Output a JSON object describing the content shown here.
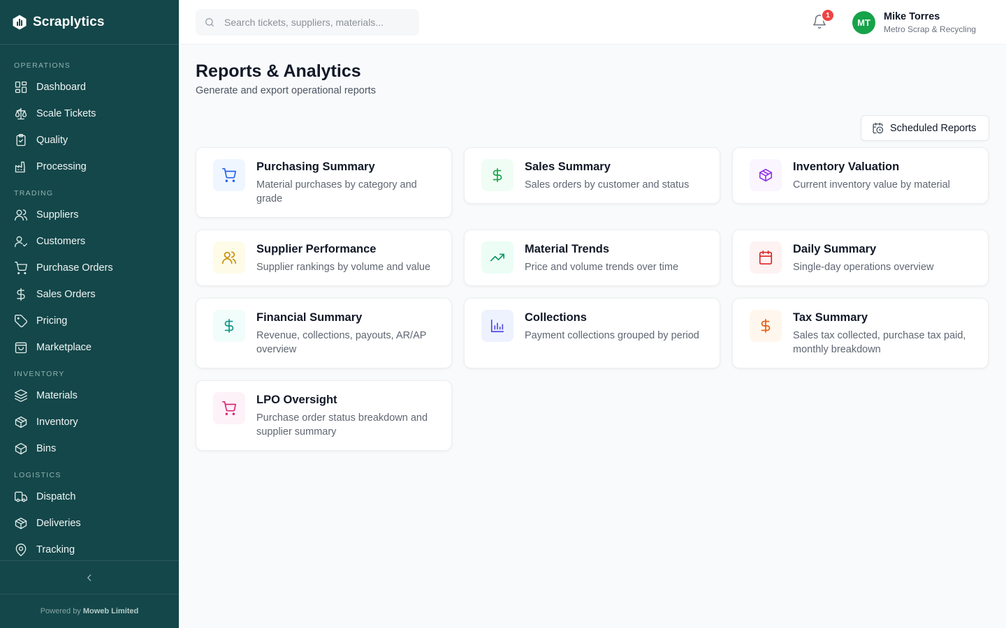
{
  "app": {
    "name": "Scraplytics"
  },
  "sidebar": {
    "sections": [
      {
        "label": "OPERATIONS",
        "items": [
          {
            "label": "Dashboard",
            "icon": "dashboard-icon"
          },
          {
            "label": "Scale Tickets",
            "icon": "scale-icon"
          },
          {
            "label": "Quality",
            "icon": "clipboard-check-icon"
          },
          {
            "label": "Processing",
            "icon": "factory-icon"
          }
        ]
      },
      {
        "label": "TRADING",
        "items": [
          {
            "label": "Suppliers",
            "icon": "users-icon"
          },
          {
            "label": "Customers",
            "icon": "user-check-icon"
          },
          {
            "label": "Purchase Orders",
            "icon": "cart-icon"
          },
          {
            "label": "Sales Orders",
            "icon": "dollar-icon"
          },
          {
            "label": "Pricing",
            "icon": "tag-icon"
          },
          {
            "label": "Marketplace",
            "icon": "shopping-bag-icon"
          }
        ]
      },
      {
        "label": "INVENTORY",
        "items": [
          {
            "label": "Materials",
            "icon": "layers-icon"
          },
          {
            "label": "Inventory",
            "icon": "package-icon"
          },
          {
            "label": "Bins",
            "icon": "box-icon"
          }
        ]
      },
      {
        "label": "LOGISTICS",
        "items": [
          {
            "label": "Dispatch",
            "icon": "truck-icon"
          },
          {
            "label": "Deliveries",
            "icon": "package-check-icon"
          },
          {
            "label": "Tracking",
            "icon": "map-pin-icon"
          }
        ]
      }
    ],
    "footer": {
      "powered_by": "Powered by",
      "company": "Moweb Limited"
    }
  },
  "header": {
    "search_placeholder": "Search tickets, suppliers, materials...",
    "notifications_count": "1",
    "user": {
      "initials": "MT",
      "name": "Mike Torres",
      "org": "Metro Scrap & Recycling"
    }
  },
  "page": {
    "title": "Reports & Analytics",
    "subtitle": "Generate and export operational reports",
    "scheduled_button": "Scheduled Reports"
  },
  "reports": [
    {
      "title": "Purchasing Summary",
      "description": "Material purchases by category and grade",
      "icon": "cart-icon",
      "icon_color": "#2563eb",
      "icon_bg": "#eff6ff"
    },
    {
      "title": "Sales Summary",
      "description": "Sales orders by customer and status",
      "icon": "dollar-icon",
      "icon_color": "#16a34a",
      "icon_bg": "#f0fdf4"
    },
    {
      "title": "Inventory Valuation",
      "description": "Current inventory value by material",
      "icon": "package-icon",
      "icon_color": "#9333ea",
      "icon_bg": "#faf5ff"
    },
    {
      "title": "Supplier Performance",
      "description": "Supplier rankings by volume and value",
      "icon": "users-icon",
      "icon_color": "#ca8a04",
      "icon_bg": "#fefce8"
    },
    {
      "title": "Material Trends",
      "description": "Price and volume trends over time",
      "icon": "trending-up-icon",
      "icon_color": "#059669",
      "icon_bg": "#ecfdf5"
    },
    {
      "title": "Daily Summary",
      "description": "Single-day operations overview",
      "icon": "calendar-icon",
      "icon_color": "#dc2626",
      "icon_bg": "#fef2f2"
    },
    {
      "title": "Financial Summary",
      "description": "Revenue, collections, payouts, AR/AP overview",
      "icon": "dollar-icon",
      "icon_color": "#0d9488",
      "icon_bg": "#f0fdfa"
    },
    {
      "title": "Collections",
      "description": "Payment collections grouped by period",
      "icon": "bar-chart-icon",
      "icon_color": "#4f46e5",
      "icon_bg": "#eef2ff"
    },
    {
      "title": "Tax Summary",
      "description": "Sales tax collected, purchase tax paid, monthly breakdown",
      "icon": "dollar-icon",
      "icon_color": "#ea580c",
      "icon_bg": "#fff7ed"
    },
    {
      "title": "LPO Oversight",
      "description": "Purchase order status breakdown and supplier summary",
      "icon": "cart-icon",
      "icon_color": "#db2777",
      "icon_bg": "#fdf2f8"
    }
  ]
}
